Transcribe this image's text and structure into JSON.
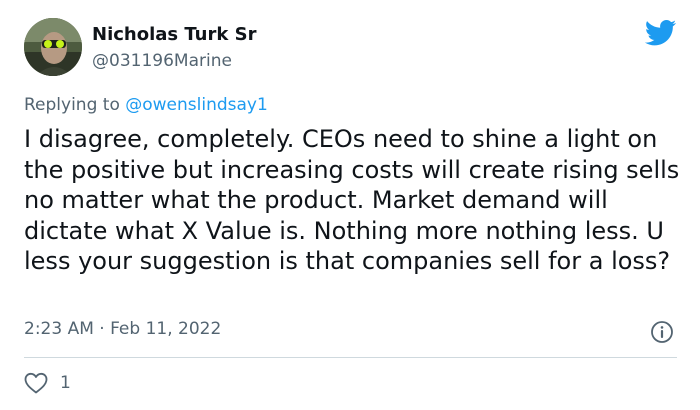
{
  "author": {
    "name": "Nicholas Turk Sr",
    "handle": "@031196Marine"
  },
  "reply": {
    "prefix": "Replying to ",
    "mention": "@owenslindsay1"
  },
  "tweet": {
    "text": "I disagree, completely. CEOs need to shine a light on the positive but increasing costs will create rising sells no matter what the product. Market demand will dictate what X Value is. Nothing more nothing less. U less your suggestion is that companies sell for a loss?",
    "timestamp": "2:23 AM · Feb 11, 2022"
  },
  "engagement": {
    "like_count": "1"
  },
  "icons": {
    "brand": "twitter-bird-icon",
    "info": "info-icon",
    "like": "heart-icon"
  },
  "colors": {
    "brand": "#1d9bf0",
    "text": "#0f1419",
    "muted": "#536471",
    "divider": "#cfd9de"
  }
}
